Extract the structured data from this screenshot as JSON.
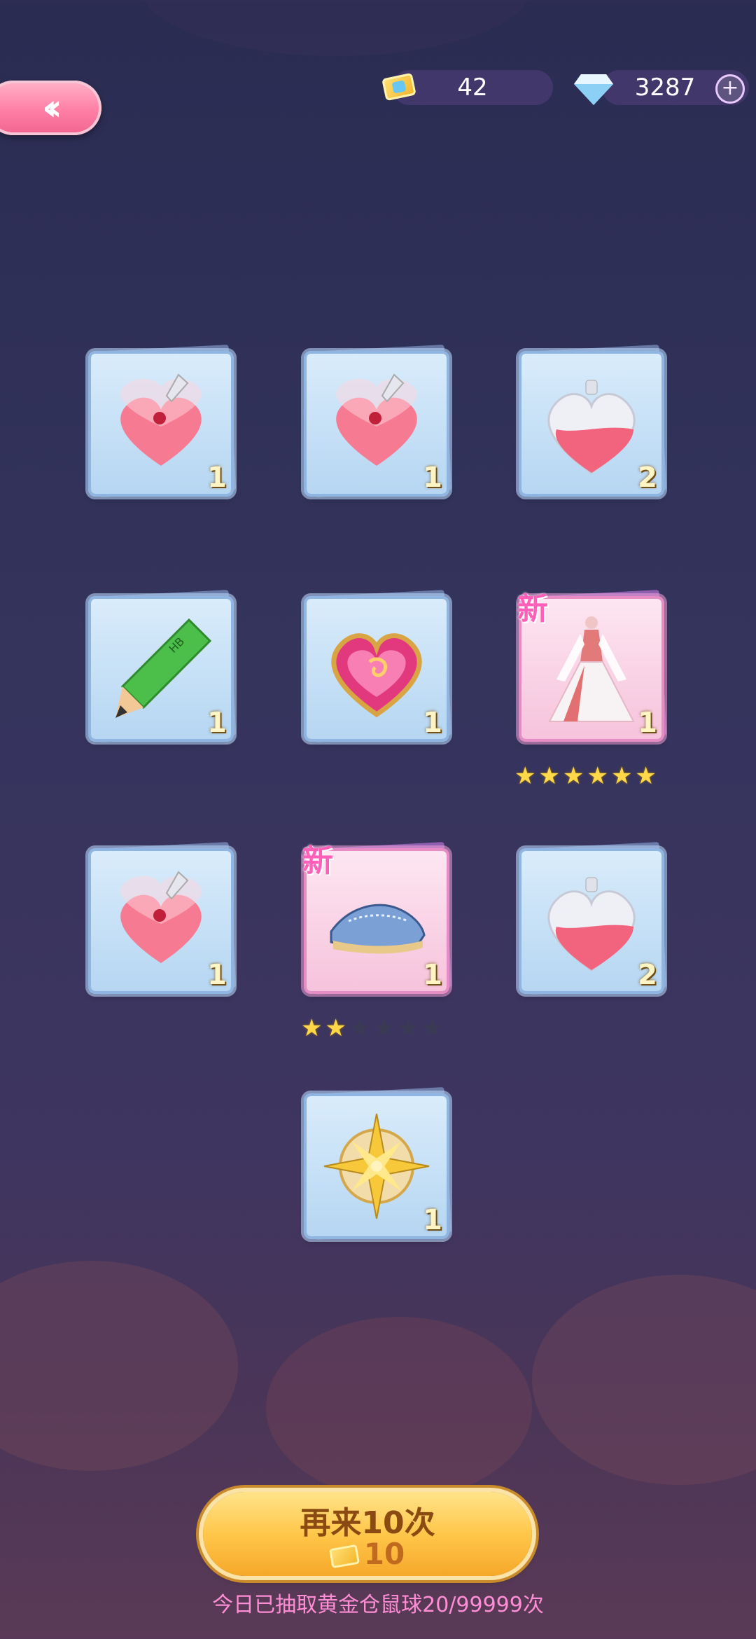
{
  "header": {
    "back_icon": "double-chevron-left",
    "tickets": "42",
    "diamonds": "3287"
  },
  "cards": [
    {
      "item": "heart-potion-tipped",
      "count": "1",
      "new": false
    },
    {
      "item": "heart-potion-tipped",
      "count": "1",
      "new": false
    },
    {
      "item": "heart-bottle",
      "count": "2",
      "new": false
    },
    {
      "item": "green-pencil",
      "count": "1",
      "new": false
    },
    {
      "item": "pink-heart-gem",
      "count": "1",
      "new": false
    },
    {
      "item": "white-dress",
      "count": "1",
      "new": true,
      "new_label": "新",
      "stars": 6
    },
    {
      "item": "heart-potion-tipped",
      "count": "1",
      "new": false
    },
    {
      "item": "shoes",
      "count": "1",
      "new": true,
      "new_label": "新",
      "stars": 2,
      "max_stars": 6
    },
    {
      "item": "heart-bottle",
      "count": "2",
      "new": false
    },
    {
      "item": "golden-compass-star",
      "count": "1",
      "new": false
    }
  ],
  "bottom": {
    "again_label": "再来10次",
    "cost": "10",
    "daily_text": "今日已抽取黄金仓鼠球20/99999次"
  },
  "colors": {
    "accent_pink": "#ff7fa6",
    "button_gold": "#ffc74a",
    "tag_pink": "#ff5fb8"
  }
}
